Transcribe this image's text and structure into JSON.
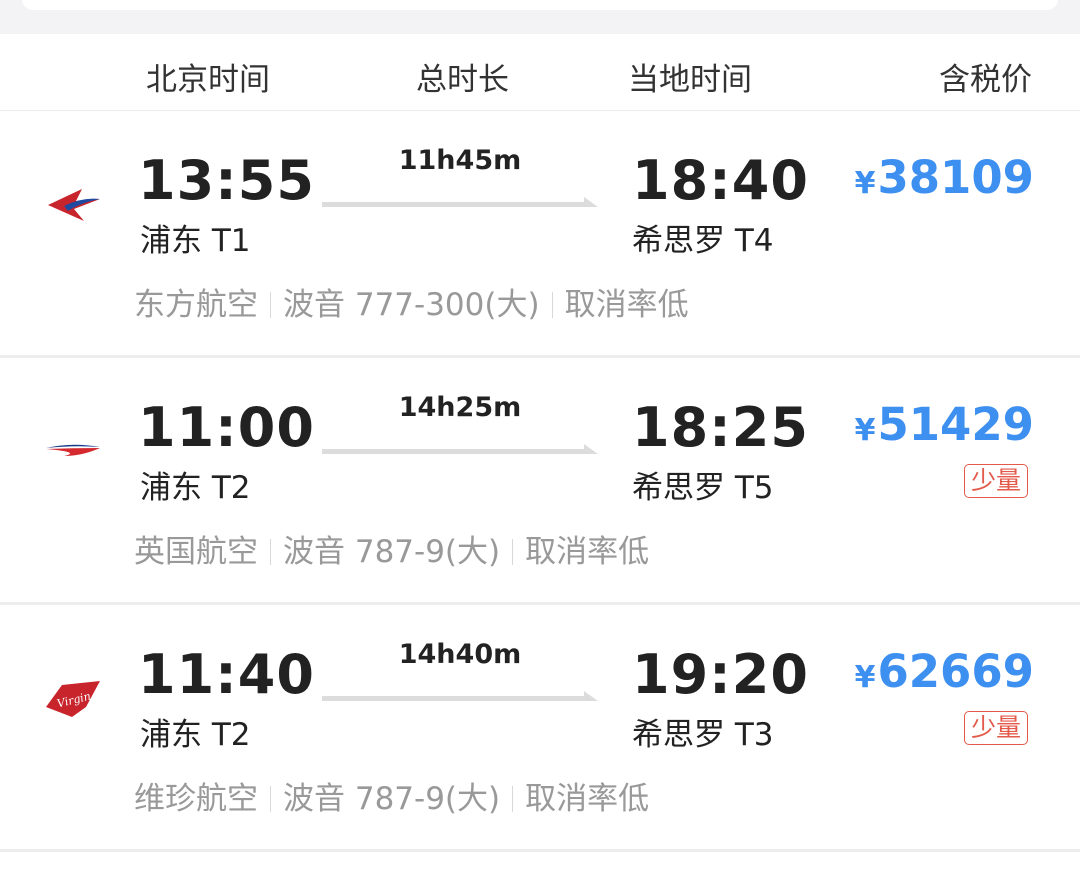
{
  "header": {
    "beijing_time": "北京时间",
    "total_duration": "总时长",
    "local_time": "当地时间",
    "price_incl_tax": "含税价"
  },
  "currency": "¥",
  "colors": {
    "price": "#3d8ff0",
    "tag": "#e35a4a",
    "muted": "#999999"
  },
  "flights": [
    {
      "airline_logo": "china-eastern-logo",
      "dep_time": "13:55",
      "dep_terminal": "浦东 T1",
      "duration": "11h45m",
      "arr_time": "18:40",
      "arr_terminal": "希思罗 T4",
      "price": "38109",
      "tag": "",
      "airline": "东方航空",
      "aircraft": "波音 777-300(大)",
      "cancel_rate": "取消率低"
    },
    {
      "airline_logo": "british-airways-logo",
      "dep_time": "11:00",
      "dep_terminal": "浦东 T2",
      "duration": "14h25m",
      "arr_time": "18:25",
      "arr_terminal": "希思罗 T5",
      "price": "51429",
      "tag": "少量",
      "airline": "英国航空",
      "aircraft": "波音 787-9(大)",
      "cancel_rate": "取消率低"
    },
    {
      "airline_logo": "virgin-atlantic-logo",
      "dep_time": "11:40",
      "dep_terminal": "浦东 T2",
      "duration": "14h40m",
      "arr_time": "19:20",
      "arr_terminal": "希思罗 T3",
      "price": "62669",
      "tag": "少量",
      "airline": "维珍航空",
      "aircraft": "波音 787-9(大)",
      "cancel_rate": "取消率低",
      "logo_text": "Virgin"
    }
  ]
}
